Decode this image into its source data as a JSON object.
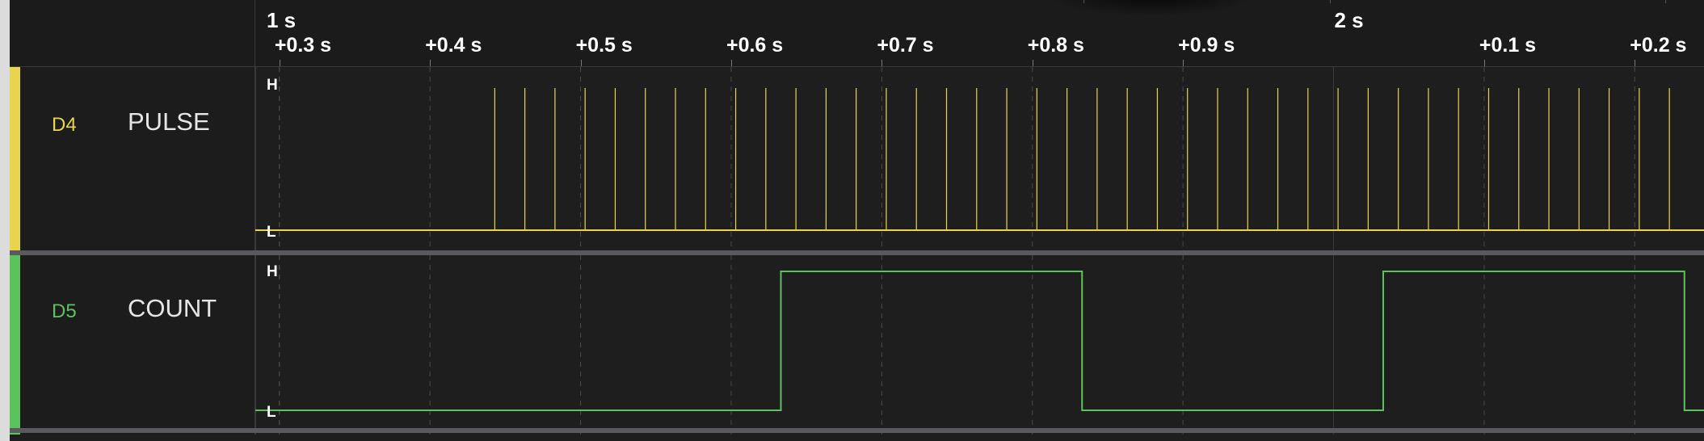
{
  "timeline": {
    "major_labels": [
      "1 s",
      "2 s"
    ],
    "minor_labels": [
      "+0.3 s",
      "+0.4 s",
      "+0.5 s",
      "+0.6 s",
      "+0.7 s",
      "+0.8 s",
      "+0.9 s",
      "+0.1 s",
      "+0.2 s"
    ]
  },
  "channels": [
    {
      "id": "D4",
      "name": "PULSE",
      "color": "#e8d44d",
      "high_label": "H",
      "low_label": "L",
      "pulse_times_s": [
        1.443,
        1.463,
        1.483,
        1.503,
        1.523,
        1.543,
        1.563,
        1.583,
        1.603,
        1.623,
        1.643,
        1.663,
        1.683,
        1.703,
        1.723,
        1.743,
        1.763,
        1.783,
        1.803,
        1.823,
        1.843,
        1.863,
        1.883,
        1.903,
        1.923,
        1.943,
        1.963,
        1.983,
        2.003,
        2.023,
        2.043,
        2.063,
        2.083,
        2.103,
        2.123,
        2.143,
        2.163,
        2.183,
        2.203,
        2.223
      ]
    },
    {
      "id": "D5",
      "name": "COUNT",
      "color": "#5cc35c",
      "high_label": "H",
      "low_label": "L",
      "initial_level": 0,
      "transition_times_s": [
        1.633,
        1.833,
        2.033,
        2.233
      ]
    }
  ],
  "view": {
    "start_time_s": 1.284,
    "end_time_s": 2.246
  }
}
